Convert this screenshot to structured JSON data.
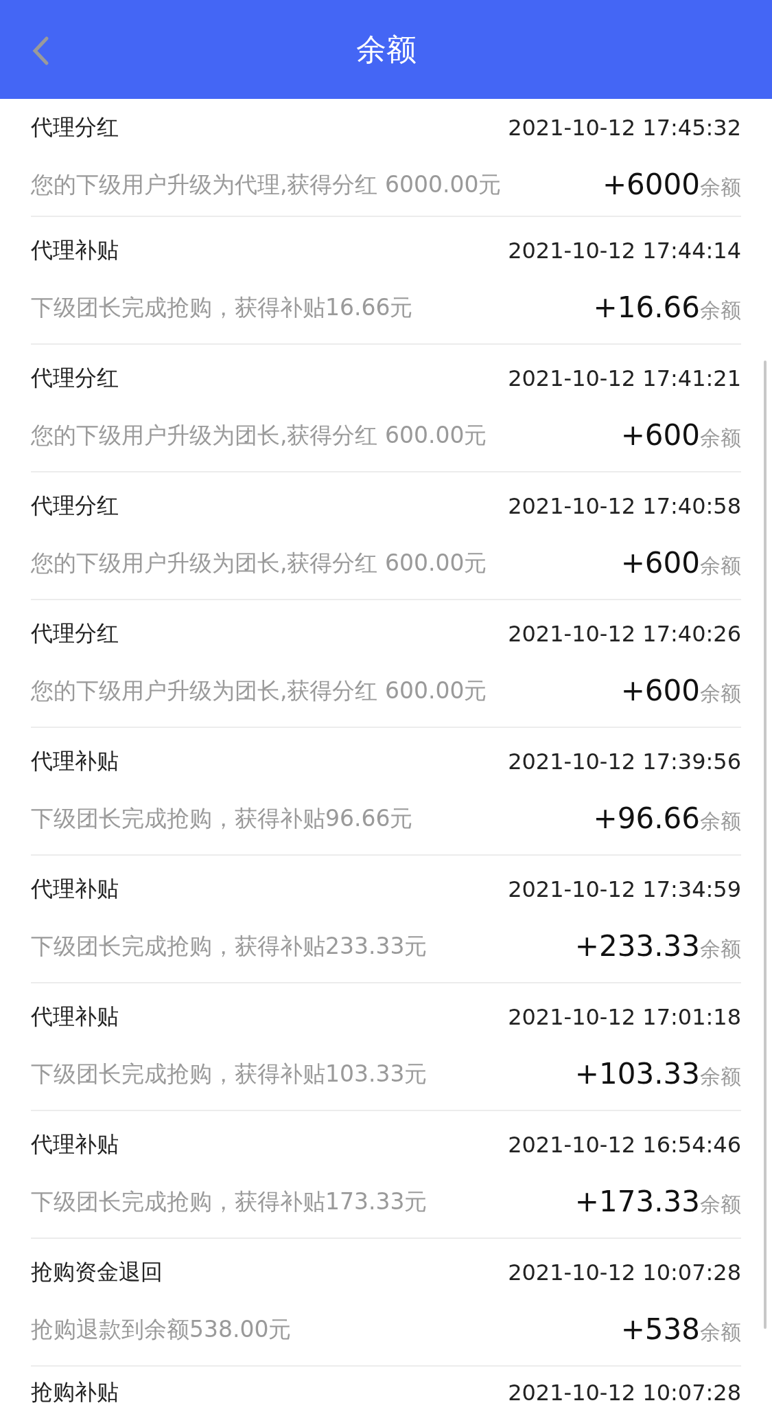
{
  "header": {
    "title": "余额"
  },
  "records": [
    {
      "title": "代理分红",
      "time": "2021-10-12 17:45:32",
      "description": "您的下级用户升级为代理,获得分红 6000.00元",
      "amount": "+6000",
      "unit": "余额"
    },
    {
      "title": "代理补贴",
      "time": "2021-10-12 17:44:14",
      "description": "下级团长完成抢购，获得补贴16.66元",
      "amount": "+16.66",
      "unit": "余额"
    },
    {
      "title": "代理分红",
      "time": "2021-10-12 17:41:21",
      "description": "您的下级用户升级为团长,获得分红 600.00元",
      "amount": "+600",
      "unit": "余额"
    },
    {
      "title": "代理分红",
      "time": "2021-10-12 17:40:58",
      "description": "您的下级用户升级为团长,获得分红 600.00元",
      "amount": "+600",
      "unit": "余额"
    },
    {
      "title": "代理分红",
      "time": "2021-10-12 17:40:26",
      "description": "您的下级用户升级为团长,获得分红 600.00元",
      "amount": "+600",
      "unit": "余额"
    },
    {
      "title": "代理补贴",
      "time": "2021-10-12 17:39:56",
      "description": "下级团长完成抢购，获得补贴96.66元",
      "amount": "+96.66",
      "unit": "余额"
    },
    {
      "title": "代理补贴",
      "time": "2021-10-12 17:34:59",
      "description": "下级团长完成抢购，获得补贴233.33元",
      "amount": "+233.33",
      "unit": "余额"
    },
    {
      "title": "代理补贴",
      "time": "2021-10-12 17:01:18",
      "description": "下级团长完成抢购，获得补贴103.33元",
      "amount": "+103.33",
      "unit": "余额"
    },
    {
      "title": "代理补贴",
      "time": "2021-10-12 16:54:46",
      "description": "下级团长完成抢购，获得补贴173.33元",
      "amount": "+173.33",
      "unit": "余额"
    },
    {
      "title": "抢购资金退回",
      "time": "2021-10-12 10:07:28",
      "description": "抢购退款到余额538.00元",
      "amount": "+538",
      "unit": "余额"
    },
    {
      "title": "抢购补贴",
      "time": "2021-10-12 10:07:28"
    }
  ]
}
